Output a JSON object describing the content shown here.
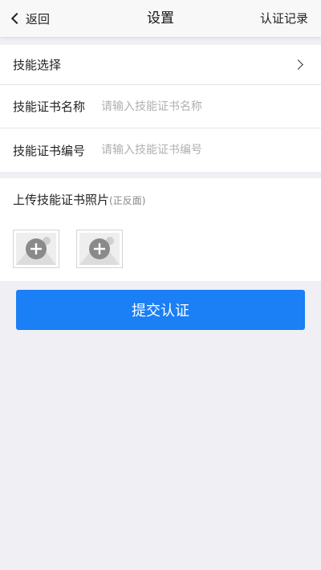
{
  "nav": {
    "back_label": "返回",
    "title": "设置",
    "right_label": "认证记录"
  },
  "form": {
    "skill_select_label": "技能选择",
    "cert_name_label": "技能证书名称",
    "cert_name_placeholder": "请输入技能证书名称",
    "cert_number_label": "技能证书编号",
    "cert_number_placeholder": "请输入技能证书编号"
  },
  "upload": {
    "title": "上传技能证书照片",
    "note": "(正反面)",
    "photo_slots": 2,
    "icons": [
      "image-placeholder-icon",
      "add-circle-icon"
    ]
  },
  "submit_label": "提交认证",
  "colors": {
    "accent": "#1b7ff5",
    "background": "#efeff4",
    "placeholder": "#b0b0b0"
  }
}
